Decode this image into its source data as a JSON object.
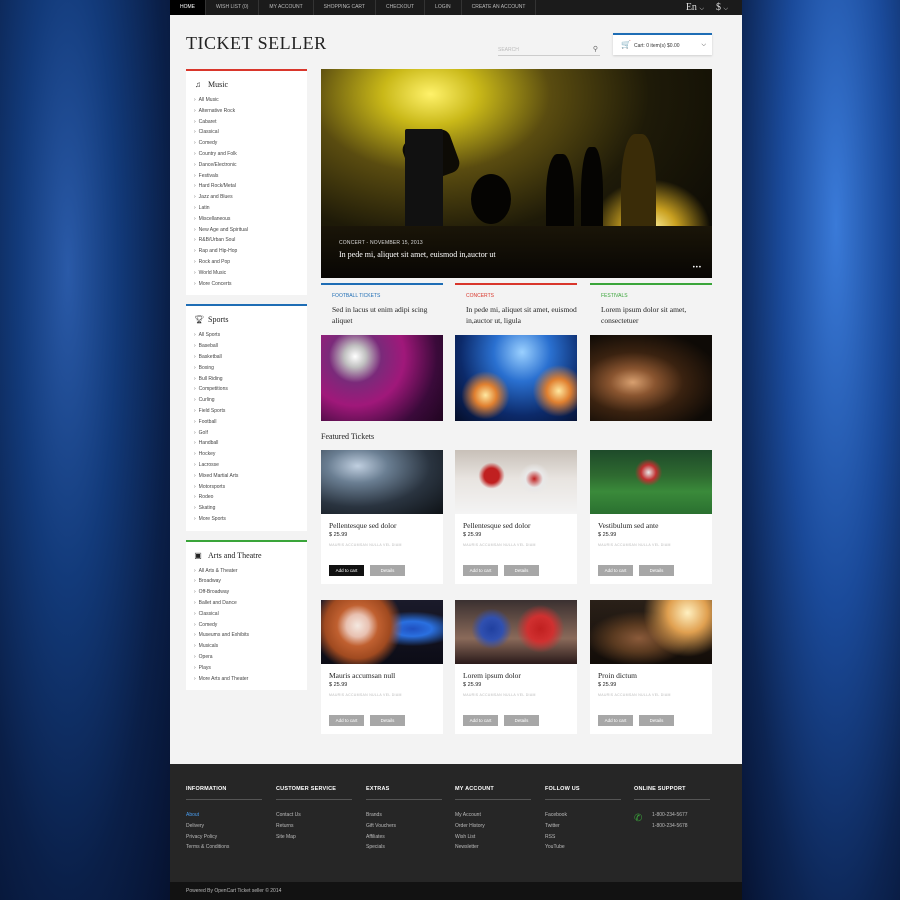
{
  "topnav": [
    "Home",
    "Wish List (0)",
    "My Account",
    "Shopping Cart",
    "Checkout",
    "Login",
    "Create an Account"
  ],
  "language": "En",
  "currency": "$",
  "logo": "TICKET SELLER",
  "search_placeholder": "SEARCH",
  "cart_text": "Cart: 0 item(s) $0.00",
  "categories": [
    {
      "title": "Music",
      "icon": "music-note-icon",
      "items": [
        "All Music",
        "Alternative Rock",
        "Cabaret",
        "Classical",
        "Comedy",
        "Country and Folk",
        "Dance/Electronic",
        "Festivals",
        "Hard Rock/Metal",
        "Jazz and Blues",
        "Latin",
        "Miscellaneous",
        "New Age and Spiritual",
        "R&B/Urban Soul",
        "Rap and Hip-Hop",
        "Rock and Pop",
        "World Music",
        "More Concerts"
      ]
    },
    {
      "title": "Sports",
      "icon": "trophy-icon",
      "items": [
        "All Sports",
        "Baseball",
        "Basketball",
        "Boxing",
        "Bull Riding",
        "Competitions",
        "Curling",
        "Field Sports",
        "Football",
        "Golf",
        "Handball",
        "Hockey",
        "Lacrosse",
        "Mixed Martial Arts",
        "Motorsports",
        "Rodeo",
        "Skating",
        "More Sports"
      ]
    },
    {
      "title": "Arts and Theatre",
      "icon": "picture-icon",
      "items": [
        "All Arts & Theater",
        "Broadway",
        "Off-Broadway",
        "Ballet and Dance",
        "Classical",
        "Comedy",
        "Museums and Exhibits",
        "Musicals",
        "Opera",
        "Plays",
        "More Arts and Theater"
      ]
    }
  ],
  "slider": {
    "caption_small": "CONCERT - NOVEMBER 15, 2013",
    "caption": "In pede mi, aliquet sit amet, euismod in,auctor ut"
  },
  "promos": [
    {
      "label": "Football tickets",
      "text": "Sed in lacus ut enim adipi scing aliquet",
      "color": "#1e6db5"
    },
    {
      "label": "Concerts",
      "text": "In pede mi, aliquet sit amet, euismod in,auctor ut, ligula",
      "color": "#d9362b"
    },
    {
      "label": "Festivals",
      "text": "Lorem ipsum dolor sit amet, consectetuer",
      "color": "#3aa53a"
    }
  ],
  "featured_title": "Featured Tickets",
  "products": [
    {
      "name": "Pellentesque sed dolor",
      "price": "$ 25.99",
      "desc": "MAURIS ACCUMSAN NULLA VEL DIAM"
    },
    {
      "name": "Pellentesque sed dolor",
      "price": "$ 25.99",
      "desc": "MAURIS ACCUMSAN NULLA VEL DIAM"
    },
    {
      "name": "Vestibulum sed ante",
      "price": "$ 25.99",
      "desc": "MAURIS ACCUMSAN NULLA VEL DIAM"
    },
    {
      "name": "Mauris accumsan null",
      "price": "$ 25.99",
      "desc": "MAURIS ACCUMSAN NULLA VEL DIAM"
    },
    {
      "name": "Lorem ipsum dolor",
      "price": "$ 25.99",
      "desc": "MAURIS ACCUMSAN NULLA VEL DIAM"
    },
    {
      "name": "Proin dictum",
      "price": "$ 25.99",
      "desc": "MAURIS ACCUMSAN NULLA VEL DIAM"
    }
  ],
  "add_to_cart": "Add to cart",
  "details": "Details",
  "footer": [
    {
      "title": "INFORMATION",
      "items": [
        "About",
        "Delivery",
        "Privacy Policy",
        "Terms & Conditions"
      ]
    },
    {
      "title": "CUSTOMER SERVICE",
      "items": [
        "Contact Us",
        "Returns",
        "Site Map"
      ]
    },
    {
      "title": "EXTRAS",
      "items": [
        "Brands",
        "Gift Vouchers",
        "Affiliates",
        "Specials"
      ]
    },
    {
      "title": "MY ACCOUNT",
      "items": [
        "My Account",
        "Order History",
        "Wish List",
        "Newsletter"
      ]
    },
    {
      "title": "FOLLOW US",
      "items": [
        "Facebook",
        "Twitter",
        "RSS",
        "YouTube"
      ]
    },
    {
      "title": "ONLINE SUPPORT",
      "items": [
        "1-800-234-5677",
        "1-800-234-5678"
      ]
    }
  ],
  "copyright": "Powered By OpenCart Ticket seller © 2014"
}
